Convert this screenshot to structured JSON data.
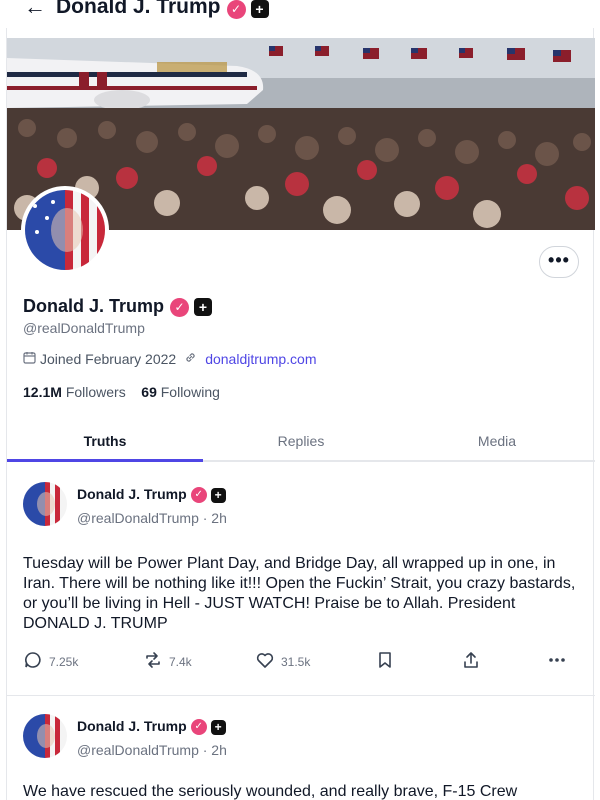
{
  "header": {
    "back_glyph": "←",
    "title": "Donald J. Trump"
  },
  "profile": {
    "name": "Donald J. Trump",
    "handle": "@realDonaldTrump",
    "joined": "Joined February 2022",
    "website": "donaldjtrump.com",
    "followers_count": "12.1M",
    "followers_label": "Followers",
    "following_count": "69",
    "following_label": "Following",
    "more_glyph": "•••"
  },
  "tabs": [
    {
      "label": "Truths",
      "active": true
    },
    {
      "label": "Replies",
      "active": false
    },
    {
      "label": "Media",
      "active": false
    }
  ],
  "posts": [
    {
      "author": "Donald J. Trump",
      "handle_time": "@realDonaldTrump · 2h",
      "text": "Tuesday will be Power Plant Day, and Bridge Day, all wrapped up in one, in Iran. There will be nothing like it!!! Open the Fuckin’ Strait, you crazy bastards, or you’ll be living in Hell - JUST WATCH! Praise be to Allah. President DONALD J. TRUMP",
      "replies": "7.25k",
      "retruths": "7.4k",
      "likes": "31.5k"
    },
    {
      "author": "Donald J. Trump",
      "handle_time": "@realDonaldTrump · 2h",
      "text": "We have rescued the seriously wounded, and really brave, F-15 Crew"
    }
  ],
  "icons": {
    "back": "arrow-left-icon",
    "verified": "verified-badge-icon",
    "plus": "plus-badge-icon",
    "calendar": "calendar-icon",
    "link": "link-icon",
    "reply": "reply-icon",
    "retruth": "retruth-icon",
    "like": "heart-icon",
    "bookmark": "bookmark-icon",
    "share": "share-icon",
    "more": "more-icon"
  },
  "colors": {
    "accent": "#4f46e5",
    "verified": "#e9457a",
    "text": "#111827",
    "muted": "#6b7280"
  }
}
